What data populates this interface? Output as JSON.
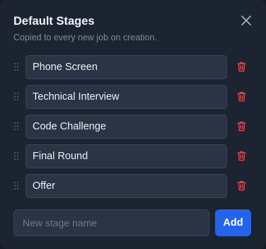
{
  "dialog": {
    "title": "Default Stages",
    "subtitle": "Copied to every new job on creation.",
    "close_icon": "close-icon"
  },
  "stages": [
    {
      "name": "Phone Screen"
    },
    {
      "name": "Technical Interview"
    },
    {
      "name": "Code Challenge"
    },
    {
      "name": "Final Round"
    },
    {
      "name": "Offer"
    }
  ],
  "new_stage": {
    "placeholder": "New stage name",
    "value": "",
    "add_label": "Add"
  },
  "icons": {
    "drag": "drag-handle-icon",
    "delete": "trash-icon",
    "close": "close-icon"
  },
  "colors": {
    "accent": "#2563eb",
    "delete": "#e5484d",
    "background": "#1c2331",
    "input_bg": "#2a3445"
  }
}
